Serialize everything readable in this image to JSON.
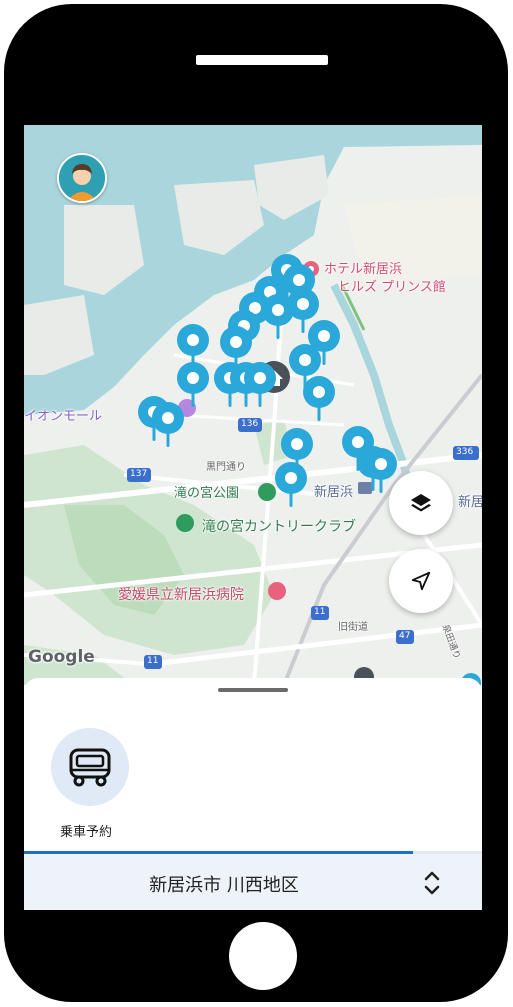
{
  "map": {
    "labels": {
      "hotel_line1": "ホテル新居浜",
      "hotel_line2": "ヒルズ プリンス館",
      "aeon": "イオンモール",
      "kuromon": "黒門通り",
      "takinomiya_park": "滝の宮公園",
      "niihama_station": "新居浜",
      "country_club": "滝の宮カントリークラブ",
      "hospital": "愛媛県立新居浜病院",
      "kyu_kaido": "旧街道",
      "road_east": "新居",
      "shima_dori": "泉田通り",
      "google": "Google",
      "route_136": "136",
      "route_137": "137",
      "route_336": "336",
      "route_11a": "11",
      "route_11b": "11",
      "route_47": "47"
    },
    "pin_color": "#29a8d9",
    "layers_icon": "layers-icon",
    "locate_icon": "navigation-arrow-icon"
  },
  "sheet": {
    "service_label": "乗車予約",
    "service_icon": "bus-icon",
    "progress_fraction": 0.85,
    "region": "新居浜市 川西地区",
    "region_toggle_icon": "chevron-updown-icon"
  }
}
